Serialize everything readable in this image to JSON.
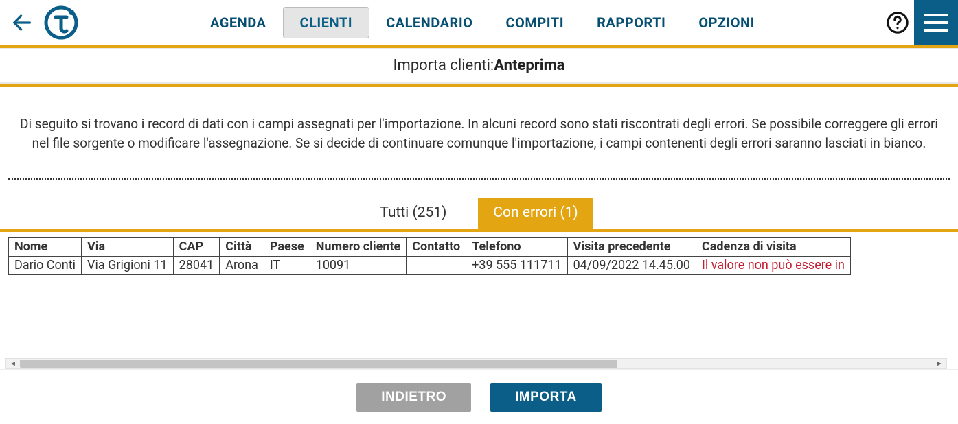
{
  "nav": {
    "tabs": [
      {
        "label": "AGENDA"
      },
      {
        "label": "CLIENTI"
      },
      {
        "label": "CALENDARIO"
      },
      {
        "label": "COMPITI"
      },
      {
        "label": "RAPPORTI"
      },
      {
        "label": "OPZIONI"
      }
    ],
    "active_index": 1
  },
  "page_title": {
    "prefix": "Importa clienti: ",
    "current": "Anteprima"
  },
  "intro": "Di seguito si trovano i record di dati con i campi assegnati per l'importazione. In alcuni record sono stati riscontrati degli errori. Se possibile correggere gli errori nel file sorgente o modificare l'assegnazione. Se si decide di continuare comunque l'importazione, i campi contenenti degli errori saranno lasciati in bianco.",
  "filter": {
    "all_label": "Tutti (251)",
    "errors_label": "Con errori (1)",
    "active": "errors"
  },
  "table": {
    "headers": [
      "Nome",
      "Via",
      "CAP",
      "Città",
      "Paese",
      "Numero cliente",
      "Contatto",
      "Telefono",
      "Visita precedente",
      "Cadenza di visita"
    ],
    "rows": [
      {
        "cells": [
          "Dario Conti",
          "Via Grigioni 11",
          "28041",
          "Arona",
          "IT",
          "10091",
          "",
          "+39 555 111711",
          "04/09/2022 14.45.00",
          "Il valore non può essere in"
        ],
        "error_col_index": 9
      }
    ]
  },
  "footer": {
    "back_label": "INDIETRO",
    "import_label": "IMPORTA"
  }
}
